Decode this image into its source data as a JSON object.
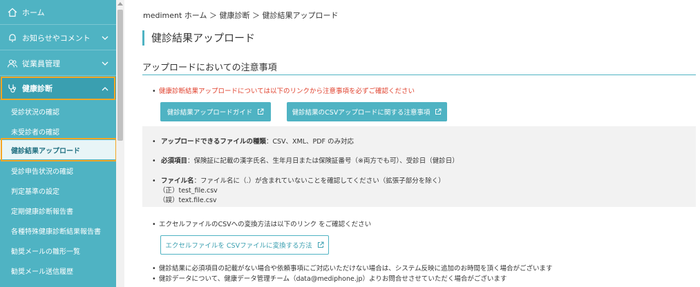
{
  "sidebar": {
    "main_items": [
      {
        "label": "ホーム",
        "icon": "home-icon"
      },
      {
        "label": "お知らせやコメント",
        "icon": "bell-icon"
      },
      {
        "label": "従業員管理",
        "icon": "users-icon"
      },
      {
        "label": "健康診断",
        "icon": "stethoscope-icon"
      }
    ],
    "sub_items": [
      {
        "label": "受診状況の確認"
      },
      {
        "label": "未受診者の確認"
      },
      {
        "label": "健診結果アップロード"
      },
      {
        "label": "受診申告状況の確認"
      },
      {
        "label": "判定基準の設定"
      },
      {
        "label": "定期健康診断報告書"
      },
      {
        "label": "各種特殊健康診断結果報告書"
      },
      {
        "label": "勧奨メールの雛形一覧"
      },
      {
        "label": "勧奨メール送信履歴"
      }
    ],
    "colors": {
      "background": "#4fb3c3",
      "active": "#3a9fb0",
      "highlight": "#f5a623"
    }
  },
  "breadcrumb": "mediment ホーム ＞ 健康診断 ＞ 健診結果アップロード",
  "page_title": "健診結果アップロード",
  "section_title": "アップロードにおいての注意事項",
  "notes": {
    "red_note": "健康診断結果アップロードについては以下のリンクから注意事項を必ずご確認ください",
    "button_guide": "健診結果アップロードガイド",
    "button_csv_notes": "健診結果のCSVアップロードに関する注意事項"
  },
  "info": {
    "file_types_label": "アップロードできるファイルの種類",
    "file_types_value": "：CSV、XML、PDF のみ対応",
    "required_label": "必須項目",
    "required_value": "：保険証に記載の漢字氏名、生年月日または保険証番号（※両方でも可）、受診日（健診日）",
    "filename_label": "ファイル名",
    "filename_value": "：ファイル名に（.）が含まれていないことを確認してください（拡張子部分を除く）",
    "example_correct": "（正）test_file.csv",
    "example_wrong": "（誤）text.file.csv"
  },
  "excel": {
    "note": "エクセルファイルのCSVへの変換方法は以下のリンク をご確認ください",
    "button": "エクセルファイルを CSVファイルに変換する方法"
  },
  "footer_notes": [
    "健診結果に必須項目の記載がない場合や依頼事項にご対応いただけない場合は、システム反映に追加のお時間を頂く場合がございます",
    "健診データについて、健康データ管理チーム（data@mediphone.jp）よりお問合せさせていただく場合がございます"
  ],
  "colors": {
    "accent": "#4fb3c3",
    "warning_text": "#e0412d",
    "info_bg": "#f2f2f2"
  }
}
